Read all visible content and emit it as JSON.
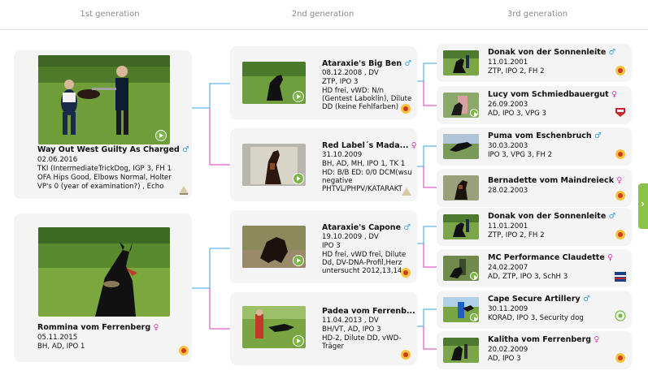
{
  "headers": [
    "1st generation",
    "2nd generation",
    "3rd generation"
  ],
  "colors": {
    "male": "#3aa3e3",
    "female": "#e03ab8",
    "play": "#7ab648",
    "tab": "#8bc34a"
  },
  "gen1": {
    "sire": {
      "name": "Way Out West Guilty As Charged",
      "sex": "♂",
      "date": "02.06.2016",
      "l1": "TKI (IntermediateTrickDog, IGP 3, FH 1",
      "l2": "OFA Hips Good, Elbows Normal, Holter",
      "l3": "VP's 0 (year of examination?) , Echo"
    },
    "dam": {
      "name": "Rommina vom Ferrenberg",
      "sex": "♀",
      "date": "05.11.2015",
      "l1": "BH, AD, IPO 1"
    }
  },
  "gen2": [
    {
      "name": "Ataraxie's Big Ben",
      "sex": "♂",
      "date": "08.12.2008 , DV",
      "l1": "ZTP, IPO 3",
      "l2": "HD frei, vWD: N/n",
      "l3": "(Gentest Laboklin), Dilute",
      "l4": "DD (keine Fehlfarben)"
    },
    {
      "name": "Red Label´s Mada...",
      "sex": "♀",
      "date": "31.10.2009",
      "l1": "BH, AD, MH, IPO 1, TK 1",
      "l2": "HD: B/B ED: 0/0 DCM(wsu",
      "l3": "negative",
      "l4": "PHTVL/PHPV/KATARAKT"
    },
    {
      "name": "Ataraxie's Capone",
      "sex": "♂",
      "date": "19.10.2009 , DV",
      "l1": "IPO 3",
      "l2": "HD frei, vWD frei, Dilute",
      "l3": "Dd, DV-DNA-Profil,Herz",
      "l4": "untersucht 2012,13,14."
    },
    {
      "name": "Padea vom Ferrenb...",
      "sex": "♀",
      "date": "11.04.2013 , DV",
      "l1": "BH/VT, AD, IPO 3",
      "l2": "HD-2, Dilute DD, vWD-",
      "l3": "Träger",
      "l4": ""
    }
  ],
  "gen3": [
    {
      "name": "Donak von der Sonnenleite",
      "sex": "♂",
      "date": "11.01.2001",
      "l1": "ZTP, IPO 2, FH 2"
    },
    {
      "name": "Lucy vom Schmiedbauergut",
      "sex": "♀",
      "date": "26.09.2003",
      "l1": "AD, IPO 3, VPG 3"
    },
    {
      "name": "Puma vom Eschenbruch",
      "sex": "♂",
      "date": "30.03.2003",
      "l1": "IPO 3, VPG 3, FH 2"
    },
    {
      "name": "Bernadette vom Maindreieck",
      "sex": "♀",
      "date": "28.02.2003",
      "l1": ""
    },
    {
      "name": "Donak von der Sonnenleite",
      "sex": "♂",
      "date": "11.01.2001",
      "l1": "ZTP, IPO 2, FH 2"
    },
    {
      "name": "MC Performance Claudette",
      "sex": "♀",
      "date": "24.02.2007",
      "l1": "AD, ZTP, IPO 3, SchH 3"
    },
    {
      "name": "Cape Secure Artillery",
      "sex": "♂",
      "date": "30.11.2009",
      "l1": "KORAD, IPO 3, Security dog"
    },
    {
      "name": "Kalitha vom Ferrenberg",
      "sex": "♀",
      "date": "20.02.2009",
      "l1": "AD, IPO 3"
    }
  ]
}
